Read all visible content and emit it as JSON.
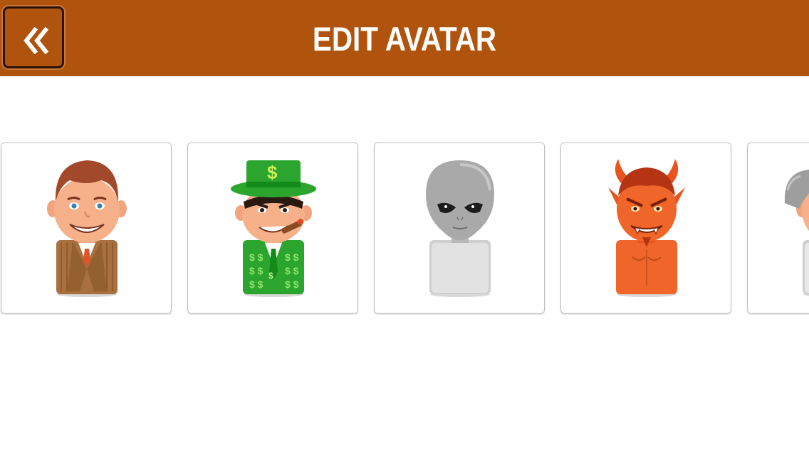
{
  "header": {
    "title": "EDIT AVATAR",
    "back_icon": "double-chevron-left-icon",
    "background_color": "#b0530d"
  },
  "avatars": [
    {
      "name": "businessman",
      "icon": "businessman-avatar-icon"
    },
    {
      "name": "money-man",
      "icon": "money-man-avatar-icon"
    },
    {
      "name": "alien",
      "icon": "alien-avatar-icon"
    },
    {
      "name": "devil",
      "icon": "devil-avatar-icon"
    },
    {
      "name": "old-man",
      "icon": "old-man-avatar-icon"
    }
  ]
}
